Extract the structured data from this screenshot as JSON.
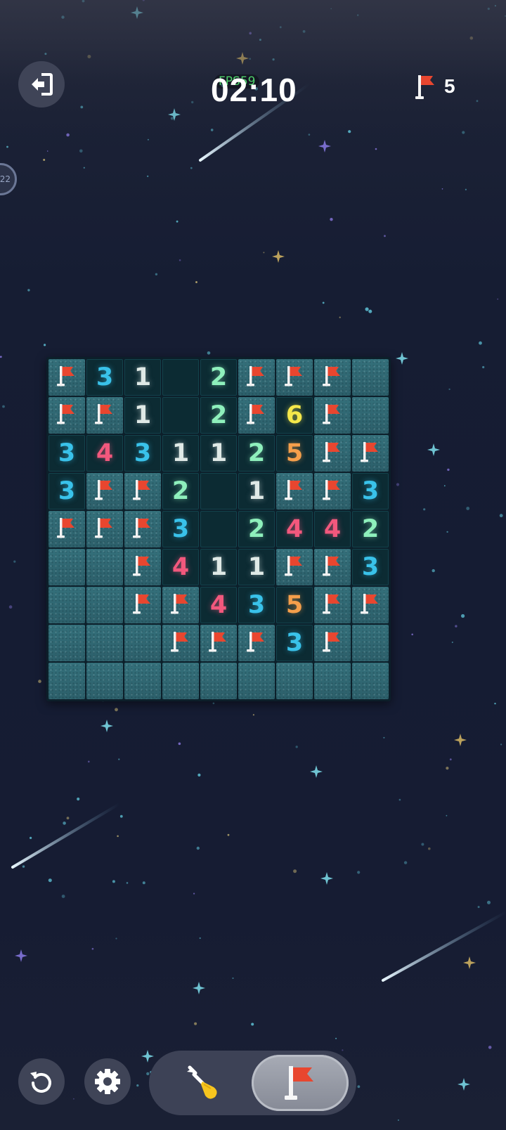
{
  "header": {
    "fps_label": "FPS59",
    "timer": "02:10",
    "flags_remaining": "5",
    "side_badge": "22"
  },
  "board": {
    "rows": 9,
    "cols": 9,
    "cells": [
      [
        "F",
        "3",
        "1",
        "0",
        "2",
        "F",
        "F",
        "F",
        "C"
      ],
      [
        "F",
        "F",
        "1",
        "0",
        "2",
        "F",
        "6",
        "F",
        "C"
      ],
      [
        "3",
        "4",
        "3",
        "1",
        "1",
        "2",
        "5",
        "F",
        "F"
      ],
      [
        "3",
        "F",
        "F",
        "2",
        "0",
        "1",
        "F",
        "F",
        "3"
      ],
      [
        "F",
        "F",
        "F",
        "3",
        "0",
        "2",
        "4",
        "4",
        "2"
      ],
      [
        "C",
        "C",
        "F",
        "4",
        "1",
        "1",
        "F",
        "F",
        "3"
      ],
      [
        "C",
        "C",
        "F",
        "F",
        "4",
        "3",
        "5",
        "F",
        "F"
      ],
      [
        "C",
        "C",
        "C",
        "F",
        "F",
        "F",
        "3",
        "F",
        "C"
      ],
      [
        "C",
        "C",
        "C",
        "C",
        "C",
        "C",
        "C",
        "C",
        "C"
      ]
    ],
    "legend": {
      "F": "flag",
      "C": "covered",
      "0": "empty"
    },
    "number_colors": {
      "1": "#dfe9e6",
      "2": "#8ef0bc",
      "3": "#39c2ea",
      "4": "#f2587d",
      "5": "#f59f4b",
      "6": "#f5e84a"
    }
  },
  "toolbar": {
    "active_tool": "flag",
    "tools": [
      "dig",
      "flag"
    ]
  },
  "icons": {
    "exit": "exit-icon",
    "undo": "undo-icon",
    "settings": "gear-icon",
    "dig": "shovel-icon",
    "flag": "flag-icon"
  },
  "colors": {
    "flag_red": "#e8462f",
    "closed_cell": "#2d5e69",
    "open_cell": "#0c2b33"
  }
}
